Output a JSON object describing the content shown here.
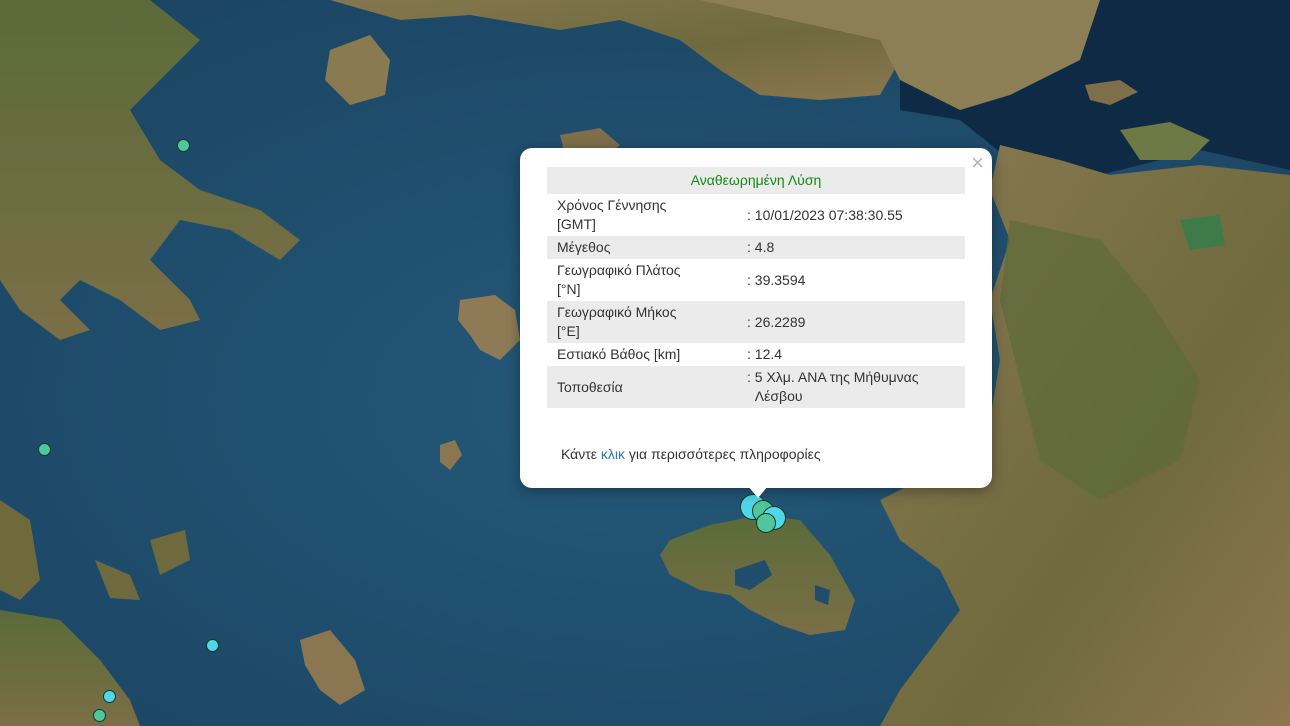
{
  "popup": {
    "title": "Αναθεωρημένη Λύση",
    "close_symbol": "×",
    "rows": [
      {
        "label_line1": "Χρόνος Γέννησης",
        "label_line2": "[GMT]",
        "value": ": 10/01/2023 07:38:30.55"
      },
      {
        "label_line1": "Μέγεθος",
        "label_line2": "",
        "value": ": 4.8"
      },
      {
        "label_line1": "Γεωγραφικό Πλάτος",
        "label_line2": "[°N]",
        "value": ": 39.3594"
      },
      {
        "label_line1": "Γεωγραφικό Μήκος",
        "label_line2": "[°E]",
        "value": ": 26.2289"
      },
      {
        "label_line1": "Εστιακό Βάθος [km]",
        "label_line2": "",
        "value": ": 12.4"
      },
      {
        "label_line1": "Τοποθεσία",
        "label_line2": "",
        "value_line1": ": 5 Χλμ. ΑΝΑ της Μήθυμνας",
        "value_line2": "Λέσβου"
      }
    ],
    "footer_before": "Κάντε ",
    "footer_link": "κλικ",
    "footer_after": " για περισσότερες πληροφορίες"
  },
  "colors": {
    "sea": "#1f4d6b",
    "land": "#7a6a45",
    "title_green": "#128a12",
    "link_blue": "#2a7ab5",
    "marker_green": "#4fc79a",
    "marker_cyan": "#4fd6e8"
  },
  "markers": {
    "icon": "earthquake-epicenter-circle"
  }
}
